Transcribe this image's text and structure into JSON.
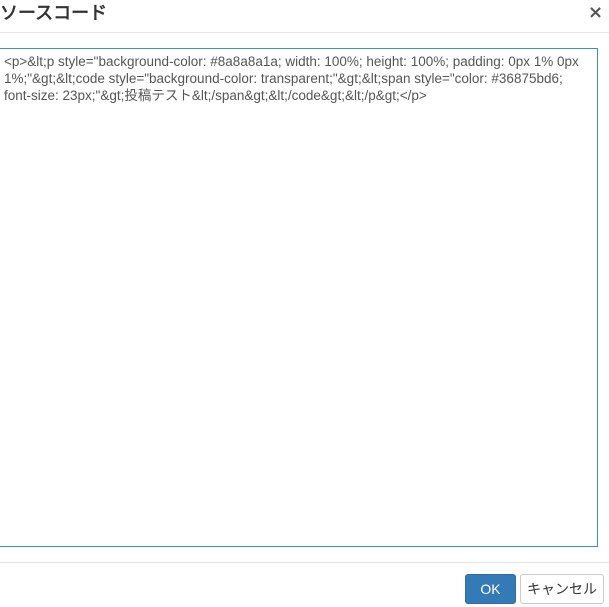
{
  "dialog": {
    "title": "ソースコード",
    "close_glyph": "×",
    "source_text": "<p>&lt;p style=\"background-color: #8a8a8a1a; width: 100%; height: 100%; padding: 0px 1% 0px 1%;\"&gt;&lt;code style=\"background-color: transparent;\"&gt;&lt;span style=\"color: #36875bd6; font-size: 23px;\"&gt;投稿テスト&lt;/span&gt;&lt;/code&gt;&lt;/p&gt;</p>",
    "ok_label": "OK",
    "cancel_label": "キャンセル"
  },
  "colors": {
    "primary_button": "#337ab7",
    "textarea_border": "#3f8fc3"
  },
  "icons": {
    "close": "close-icon"
  }
}
